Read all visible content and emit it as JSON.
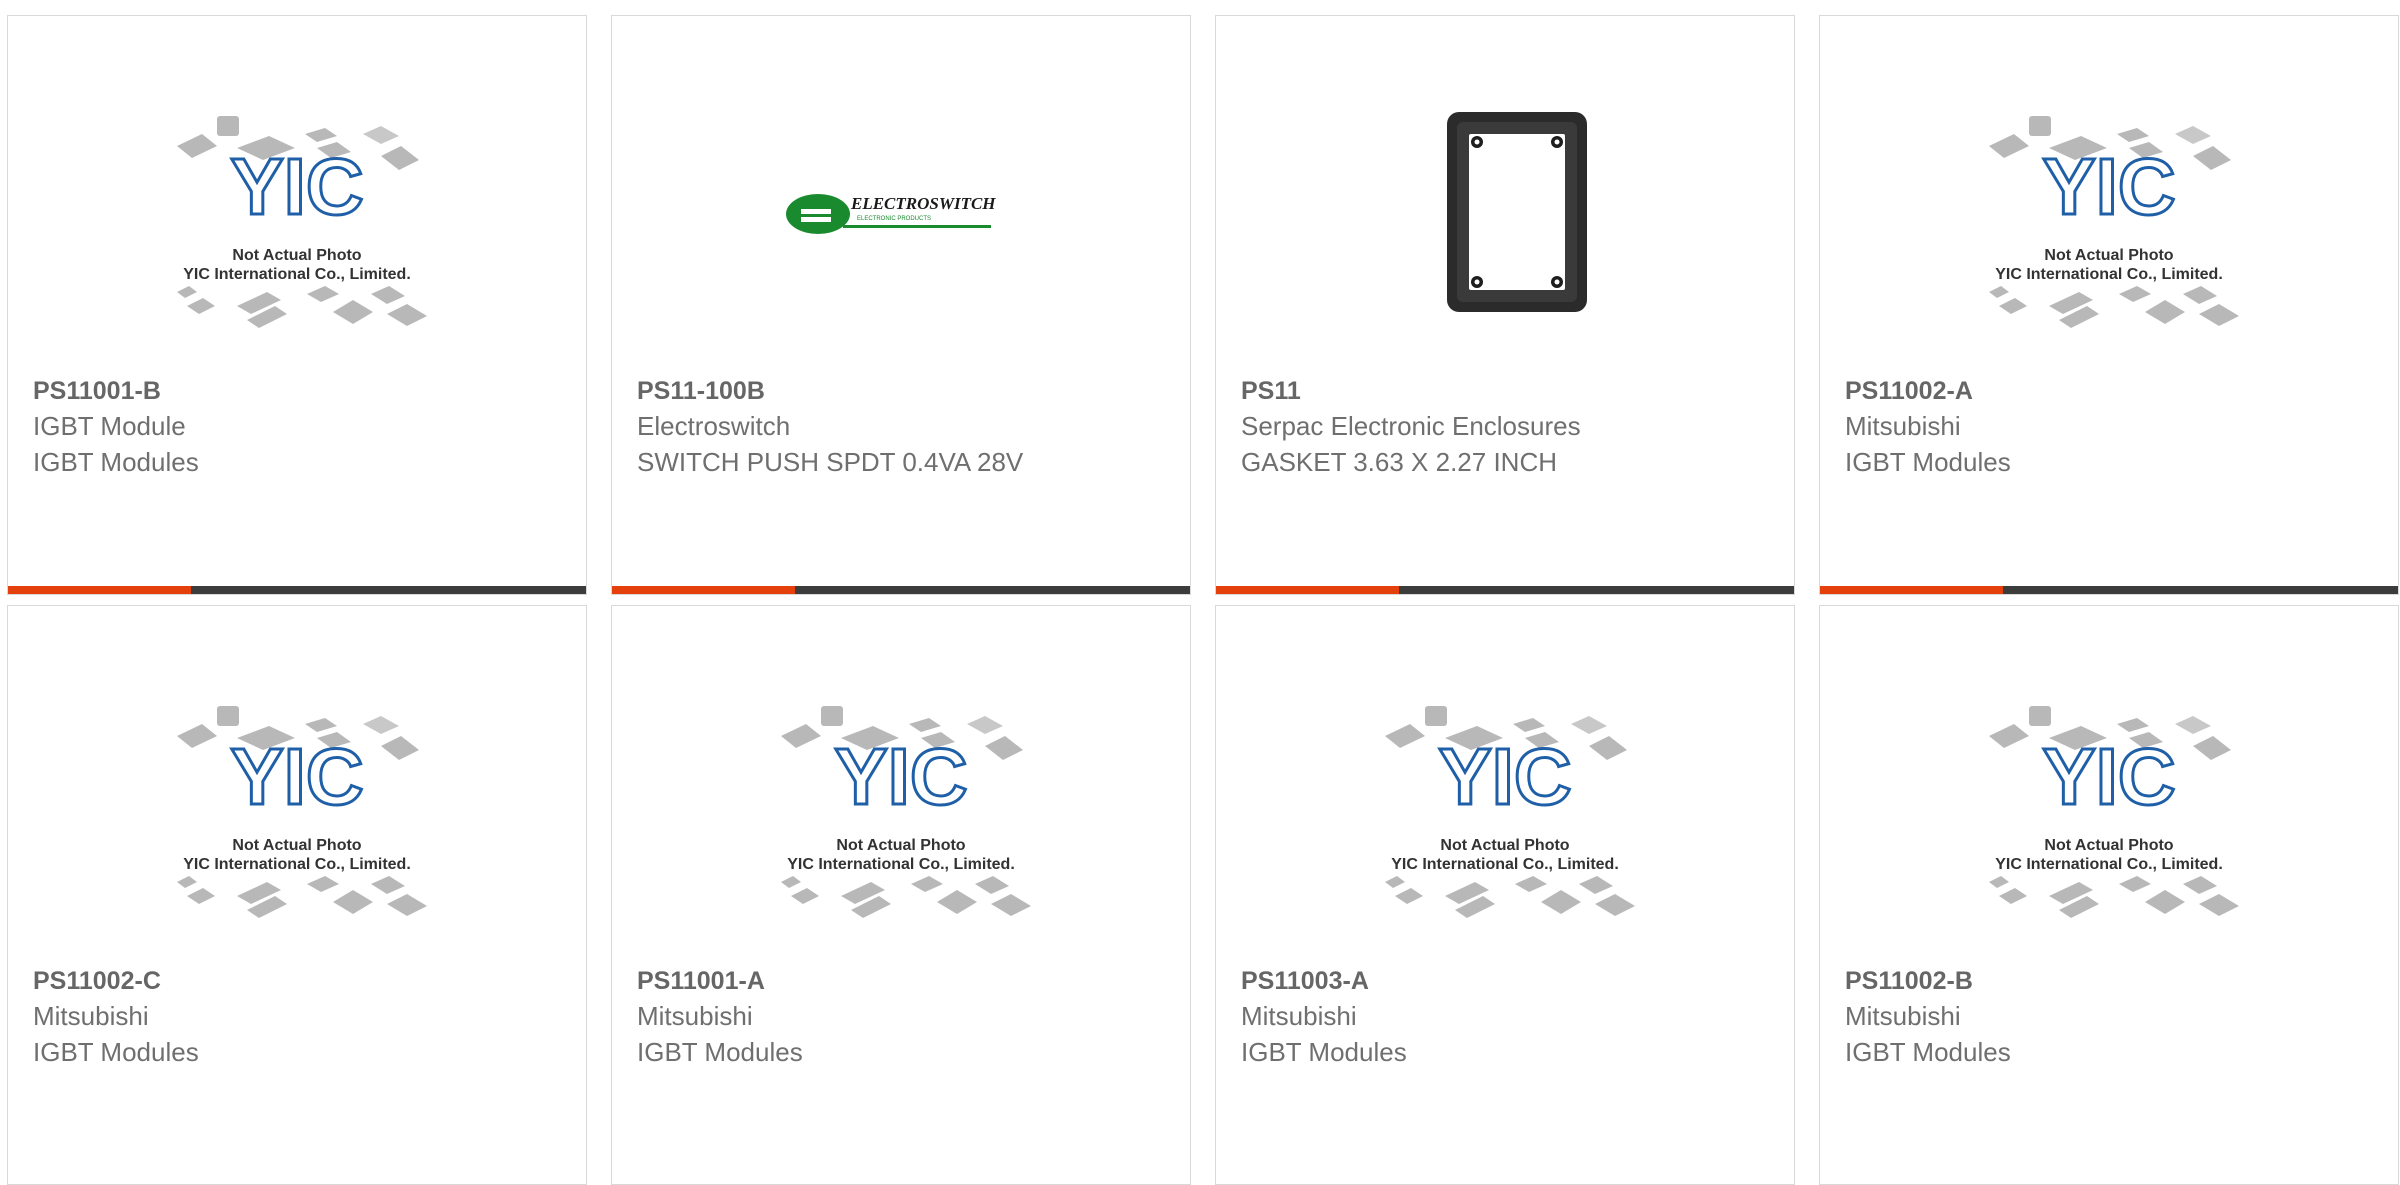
{
  "colors": {
    "accent": "#e3400b",
    "bar": "#3c3c3c",
    "border": "#d9d9d9",
    "text": "#6f6f6f",
    "logo_blue": "#1f5fa8",
    "logo_green": "#1a8a2e"
  },
  "placeholder": {
    "logo_text": "YIC",
    "line1": "Not Actual Photo",
    "line2": "YIC International Co., Limited."
  },
  "electroswitch_logo": {
    "name": "ELECTROSWITCH",
    "tagline": "ELECTRONIC PRODUCTS"
  },
  "products": [
    {
      "part": "PS11001-B",
      "line1": "IGBT Module",
      "line2": "IGBT Modules",
      "image": "yic-placeholder"
    },
    {
      "part": "PS11-100B",
      "line1": "Electroswitch",
      "line2": "SWITCH PUSH SPDT 0.4VA 28V",
      "image": "electroswitch-logo"
    },
    {
      "part": "PS11",
      "line1": "Serpac Electronic Enclosures",
      "line2": "GASKET 3.63 X 2.27 INCH",
      "image": "gasket-photo"
    },
    {
      "part": "PS11002-A",
      "line1": "Mitsubishi",
      "line2": "IGBT Modules",
      "image": "yic-placeholder"
    },
    {
      "part": "PS11002-C",
      "line1": "Mitsubishi",
      "line2": "IGBT Modules",
      "image": "yic-placeholder"
    },
    {
      "part": "PS11001-A",
      "line1": "Mitsubishi",
      "line2": "IGBT Modules",
      "image": "yic-placeholder"
    },
    {
      "part": "PS11003-A",
      "line1": "Mitsubishi",
      "line2": "IGBT Modules",
      "image": "yic-placeholder"
    },
    {
      "part": "PS11002-B",
      "line1": "Mitsubishi",
      "line2": "IGBT Modules",
      "image": "yic-placeholder"
    }
  ]
}
